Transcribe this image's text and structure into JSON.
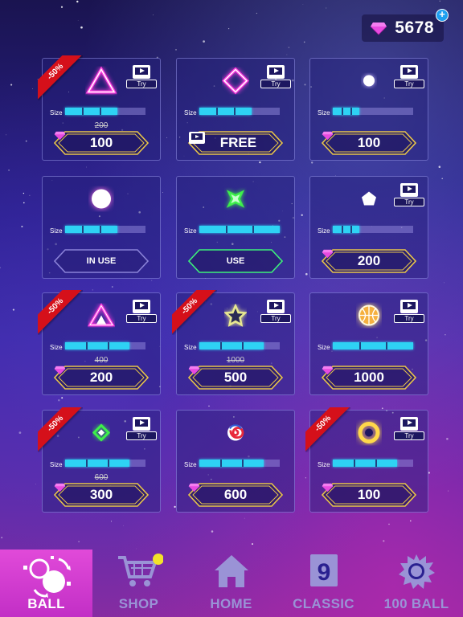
{
  "header": {
    "gem_count": "5678",
    "plus_label": "+",
    "gem_icon": "diamond-icon",
    "gem_color": "#e84ae0"
  },
  "cards": [
    {
      "ball": "triangle-outline",
      "ball_color": "#ff3ee0",
      "discount": "-50%",
      "try": "Try",
      "size_label": "Size",
      "size": 0.65,
      "old_price": "200",
      "price": "100",
      "button": "price"
    },
    {
      "ball": "diamond-outline",
      "ball_color": "#ff3ee0",
      "discount": "",
      "try": "Try",
      "size_label": "Size",
      "size": 0.65,
      "old_price": "",
      "price": "FREE",
      "button": "free"
    },
    {
      "ball": "small-dot",
      "ball_color": "#ffffff",
      "discount": "",
      "try": "Try",
      "size_label": "Size",
      "size": 0.33,
      "old_price": "",
      "price": "100",
      "button": "price"
    },
    {
      "ball": "white-circle",
      "ball_color": "#ffffff",
      "discount": "",
      "try": "",
      "size_label": "Size",
      "size": 0.65,
      "old_price": "",
      "price": "IN USE",
      "button": "inuse"
    },
    {
      "ball": "green-star",
      "ball_color": "#3df04a",
      "discount": "",
      "try": "",
      "size_label": "Size",
      "size": 1.0,
      "old_price": "",
      "price": "USE",
      "button": "use"
    },
    {
      "ball": "pentagon",
      "ball_color": "#ffffff",
      "discount": "",
      "try": "Try",
      "size_label": "Size",
      "size": 0.33,
      "old_price": "",
      "price": "200",
      "button": "price"
    },
    {
      "ball": "triforce",
      "ball_color": "#ff3ee0",
      "discount": "-50%",
      "try": "Try",
      "size_label": "Size",
      "size": 0.8,
      "old_price": "400",
      "price": "200",
      "button": "price"
    },
    {
      "ball": "star-outline",
      "ball_color": "#e8e890",
      "discount": "-50%",
      "try": "Try",
      "size_label": "Size",
      "size": 0.8,
      "old_price": "1000",
      "price": "500",
      "button": "price"
    },
    {
      "ball": "basketball",
      "ball_color": "#f5b040",
      "discount": "",
      "try": "Try",
      "size_label": "Size",
      "size": 1.0,
      "old_price": "",
      "price": "1000",
      "button": "price"
    },
    {
      "ball": "green-diamond",
      "ball_color": "#3df04a",
      "discount": "-50%",
      "try": "Try",
      "size_label": "Size",
      "size": 0.8,
      "old_price": "600",
      "price": "300",
      "button": "price"
    },
    {
      "ball": "swirl-candy",
      "ball_color": "#e8283a",
      "discount": "",
      "try": "",
      "size_label": "Size",
      "size": 0.8,
      "old_price": "",
      "price": "600",
      "button": "price"
    },
    {
      "ball": "gold-ring",
      "ball_color": "#ffd84a",
      "discount": "-50%",
      "try": "Try",
      "size_label": "Size",
      "size": 0.8,
      "old_price": "",
      "price": "100",
      "button": "price"
    }
  ],
  "nav": {
    "items": [
      {
        "label": "BALL",
        "icon": "balls-icon",
        "active": true
      },
      {
        "label": "SHOP",
        "icon": "cart-icon",
        "active": false
      },
      {
        "label": "HOME",
        "icon": "home-icon",
        "active": false
      },
      {
        "label": "CLASSIC",
        "icon": "classic-9-icon",
        "active": false,
        "icon_text": "9"
      },
      {
        "label": "100 BALL",
        "icon": "burst-ball-icon",
        "active": false
      }
    ]
  },
  "colors": {
    "accent_cyan": "#2ed2f4",
    "gold_border": "#e8c54a",
    "green_border": "#3df07a",
    "ribbon_red": "#d5101a",
    "nav_active": "#d63bd0"
  }
}
